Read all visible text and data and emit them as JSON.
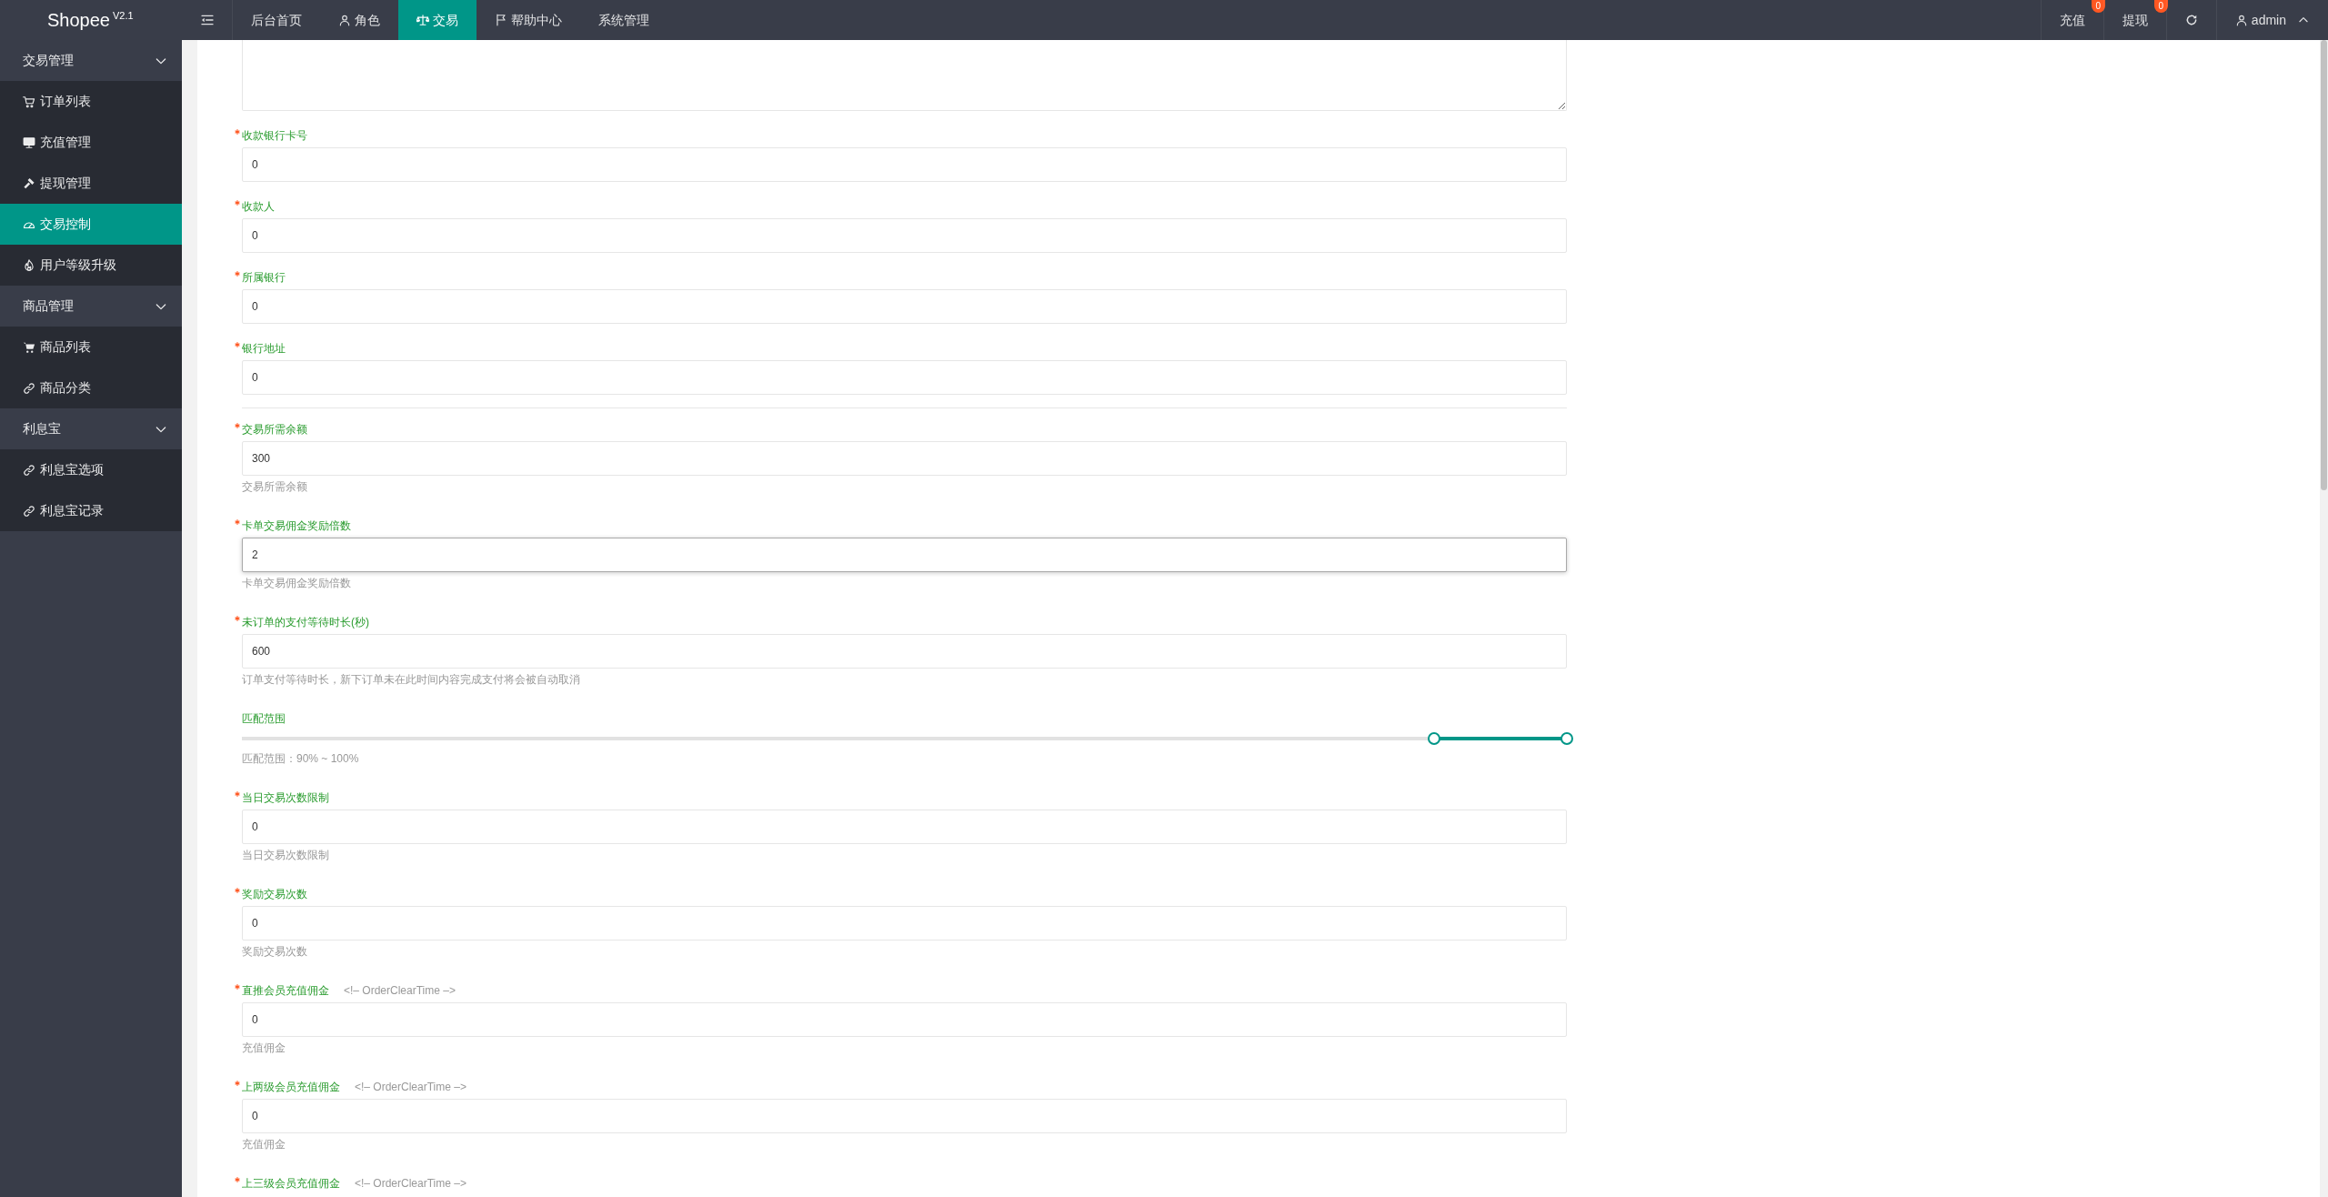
{
  "topbar": {
    "logo": "Shopee",
    "version": "V2.1",
    "nav": [
      {
        "label": "后台首页",
        "selected": false
      },
      {
        "label": "角色",
        "selected": false
      },
      {
        "label": "交易",
        "selected": true
      },
      {
        "label": "帮助中心",
        "selected": false
      },
      {
        "label": "系统管理",
        "selected": false
      }
    ],
    "actions": [
      {
        "label": "充值",
        "badge": "0"
      },
      {
        "label": "提现",
        "badge": "0"
      }
    ],
    "user": "admin"
  },
  "sidebar": {
    "groups": [
      {
        "label": "交易管理",
        "expanded": true,
        "items": [
          {
            "label": "订单列表",
            "selected": false
          },
          {
            "label": "充值管理",
            "selected": false
          },
          {
            "label": "提现管理",
            "selected": false
          },
          {
            "label": "交易控制",
            "selected": true
          },
          {
            "label": "用户等级升级",
            "selected": false
          }
        ]
      },
      {
        "label": "商品管理",
        "expanded": true,
        "items": [
          {
            "label": "商品列表",
            "selected": false
          },
          {
            "label": "商品分类",
            "selected": false
          }
        ]
      },
      {
        "label": "利息宝",
        "expanded": true,
        "items": [
          {
            "label": "利息宝选项",
            "selected": false
          },
          {
            "label": "利息宝记录",
            "selected": false
          }
        ]
      }
    ]
  },
  "form": {
    "fields": [
      {
        "kind": "textarea"
      },
      {
        "kind": "input",
        "label": "收款银行卡号",
        "required": true,
        "value": "0",
        "focused": false
      },
      {
        "kind": "input",
        "label": "收款人",
        "required": true,
        "value": "0",
        "focused": false
      },
      {
        "kind": "input",
        "label": "所属银行",
        "required": true,
        "value": "0",
        "focused": false
      },
      {
        "kind": "input",
        "label": "银行地址",
        "required": true,
        "value": "0",
        "focused": false
      },
      {
        "kind": "divider"
      },
      {
        "kind": "input",
        "label": "交易所需余额",
        "required": true,
        "value": "300",
        "help": "交易所需余额",
        "focused": false
      },
      {
        "kind": "input",
        "label": "卡单交易佣金奖励倍数",
        "required": true,
        "value": "2",
        "help": "卡单交易佣金奖励倍数",
        "focused": true
      },
      {
        "kind": "input",
        "label": "未订单的支付等待时长(秒)",
        "required": true,
        "value": "600",
        "help": "订单支付等待时长，新下订单未在此时间内容完成支付将会被自动取消",
        "focused": false
      },
      {
        "kind": "range",
        "label": "匹配范围",
        "required": false,
        "handles": [
          {
            "level": 0.9
          },
          {
            "level": 1.0
          }
        ],
        "help": "匹配范围：90% ~ 100%"
      },
      {
        "kind": "input",
        "label": "当日交易次数限制",
        "required": true,
        "value": "0",
        "help": "当日交易次数限制",
        "focused": false
      },
      {
        "kind": "input",
        "label": "奖励交易次数",
        "required": true,
        "value": "0",
        "help": "奖励交易次数",
        "focused": false
      },
      {
        "kind": "input",
        "label": "直推会员充值佣金",
        "note": "<!– OrderClearTime –>",
        "required": true,
        "value": "0",
        "help": "充值佣金",
        "focused": false
      },
      {
        "kind": "input",
        "label": "上两级会员充值佣金",
        "note": "<!– OrderClearTime –>",
        "required": true,
        "value": "0",
        "help": "充值佣金",
        "focused": false
      },
      {
        "kind": "input",
        "label": "上三级会员充值佣金",
        "note": "<!– OrderClearTime –>",
        "required": true
      }
    ]
  }
}
